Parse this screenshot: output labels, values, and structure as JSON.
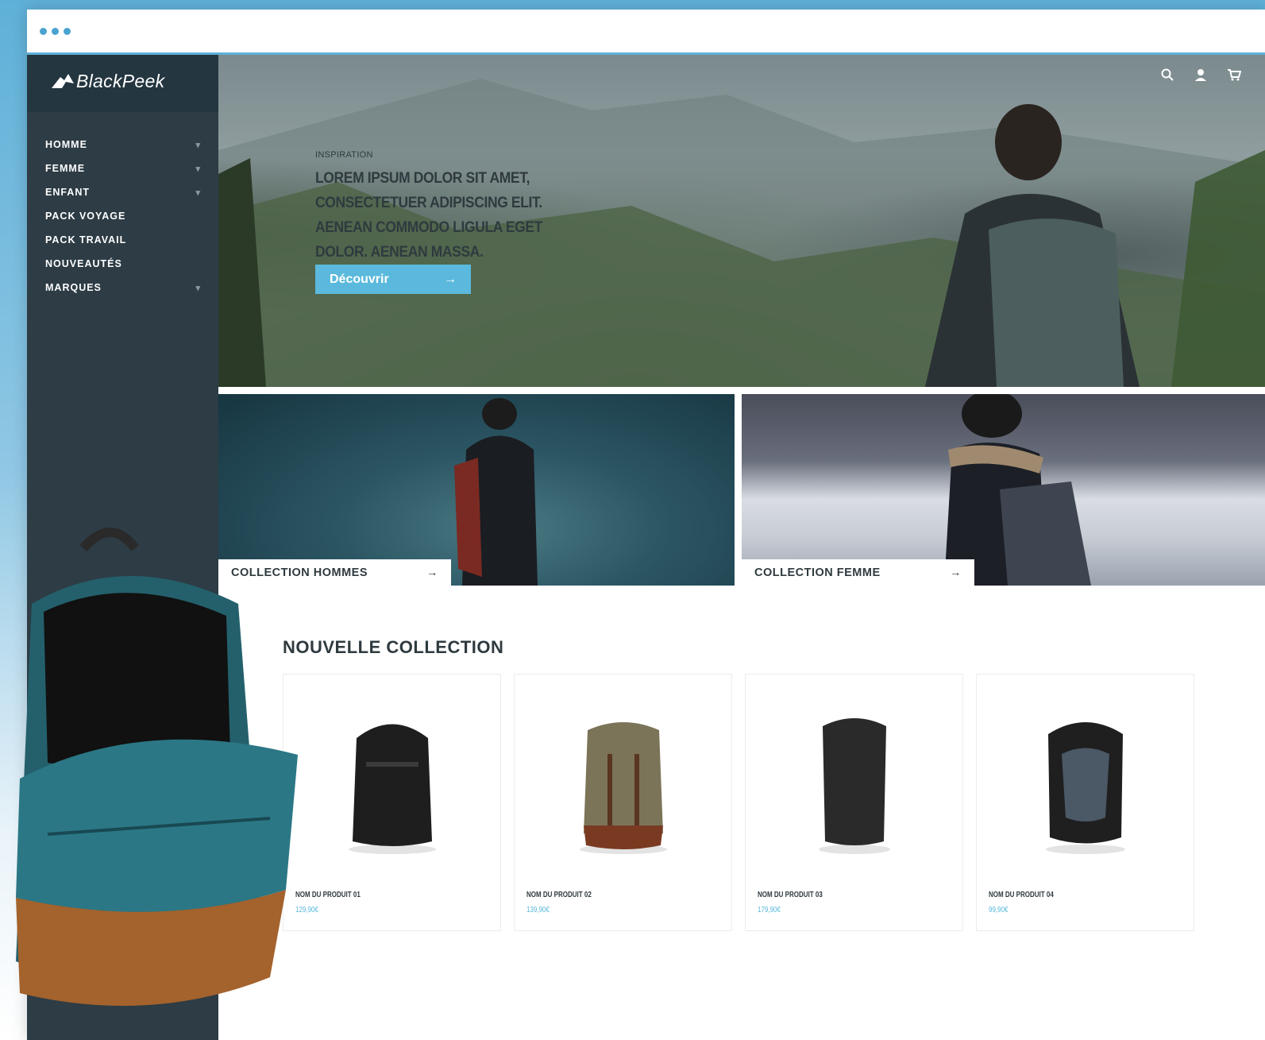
{
  "brand": {
    "name": "BlackPeek"
  },
  "nav": {
    "items": [
      {
        "label": "HOMME",
        "has_submenu": true
      },
      {
        "label": "FEMME",
        "has_submenu": true
      },
      {
        "label": "ENFANT",
        "has_submenu": true
      },
      {
        "label": "PACK VOYAGE",
        "has_submenu": false
      },
      {
        "label": "PACK TRAVAIL",
        "has_submenu": false
      },
      {
        "label": "NOUVEAUTÉS",
        "has_submenu": false
      },
      {
        "label": "MARQUES",
        "has_submenu": true
      }
    ]
  },
  "header_icons": [
    "search-icon",
    "user-icon",
    "cart-icon"
  ],
  "hero": {
    "kicker": "INSPIRATION",
    "title": "LOREM IPSUM DOLOR SIT AMET, CONSECTETUER ADIPISCING ELIT. AENEAN COMMODO LIGULA EGET DOLOR. AENEAN MASSA.",
    "button_label": "Découvrir",
    "button_arrow": "→"
  },
  "collections": [
    {
      "label": "COLLECTION HOMMES",
      "arrow": "→"
    },
    {
      "label": "COLLECTION FEMME",
      "arrow": "→"
    }
  ],
  "new_collection": {
    "title": "NOUVELLE COLLECTION",
    "products": [
      {
        "name": "NOM DU PRODUIT 01",
        "price": "129,90€"
      },
      {
        "name": "NOM DU PRODUIT 02",
        "price": "139,90€"
      },
      {
        "name": "NOM DU PRODUIT 03",
        "price": "179,90€"
      },
      {
        "name": "NOM DU PRODUIT 04",
        "price": "99,90€"
      }
    ]
  },
  "colors": {
    "accent": "#5ab9dc",
    "sidebar": "#2d3c45",
    "text_dark": "#2f3a3f"
  }
}
